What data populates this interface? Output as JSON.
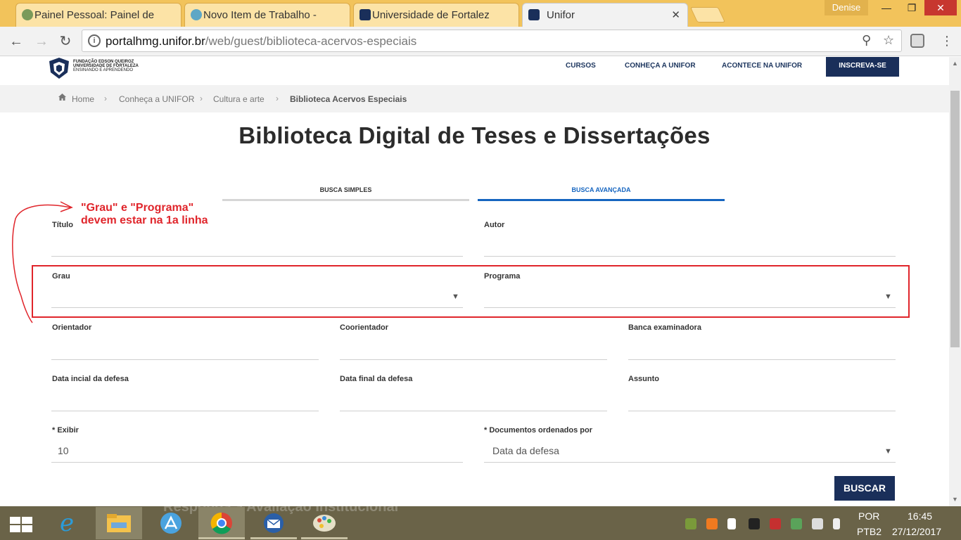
{
  "browser": {
    "tabs": [
      {
        "title": "Painel Pessoal: Painel de",
        "active": false
      },
      {
        "title": "Novo Item de Trabalho -",
        "active": false
      },
      {
        "title": "Universidade de Fortalez",
        "active": false
      },
      {
        "title": "Unifor",
        "active": true
      }
    ],
    "user": "Denise",
    "url_host": "portalhmg.unifor.br",
    "url_path": "/web/guest/biblioteca-acervos-especiais"
  },
  "site": {
    "logo_lines": [
      "FUNDAÇÃO EDSON QUEIROZ",
      "UNIVERSIDADE DE FORTALEZA",
      "ENSINANDO E APRENDENDO"
    ],
    "nav": [
      "CURSOS",
      "CONHEÇA A UNIFOR",
      "ACONTECE NA UNIFOR"
    ],
    "cta": "INSCREVA-SE"
  },
  "breadcrumb": [
    "Home",
    "Conheça a UNIFOR",
    "Cultura e arte",
    "Biblioteca Acervos Especiais"
  ],
  "page_title": "Biblioteca Digital de Teses e Dissertações",
  "search_tabs": [
    "BUSCA SIMPLES",
    "BUSCA AVANÇADA"
  ],
  "form": {
    "titulo": "Título",
    "autor": "Autor",
    "grau": "Grau",
    "programa": "Programa",
    "orientador": "Orientador",
    "coorientador": "Coorientador",
    "banca": "Banca examinadora",
    "data_inicial": "Data incial da defesa",
    "data_final": "Data final da defesa",
    "assunto": "Assunto",
    "exibir_label": "* Exibir",
    "exibir_value": "10",
    "ordenados_label": "* Documentos ordenados por",
    "ordenados_value": "Data da defesa",
    "buscar": "BUSCAR"
  },
  "annotation": {
    "line1": "\"Grau\" e \"Programa\"",
    "line2": "devem estar na 1a linha",
    "color": "#e0252b"
  },
  "taskbar": {
    "ghost_text": "Responda a Avaliação Institucional",
    "lang1": "POR",
    "lang2": "PTB2",
    "time": "16:45",
    "date": "27/12/2017"
  },
  "colors": {
    "navy": "#1a2f5a",
    "active_tab_blue": "#1565c0",
    "chrome_tabstrip": "#f2c35b",
    "taskbar": "#6a6348"
  }
}
